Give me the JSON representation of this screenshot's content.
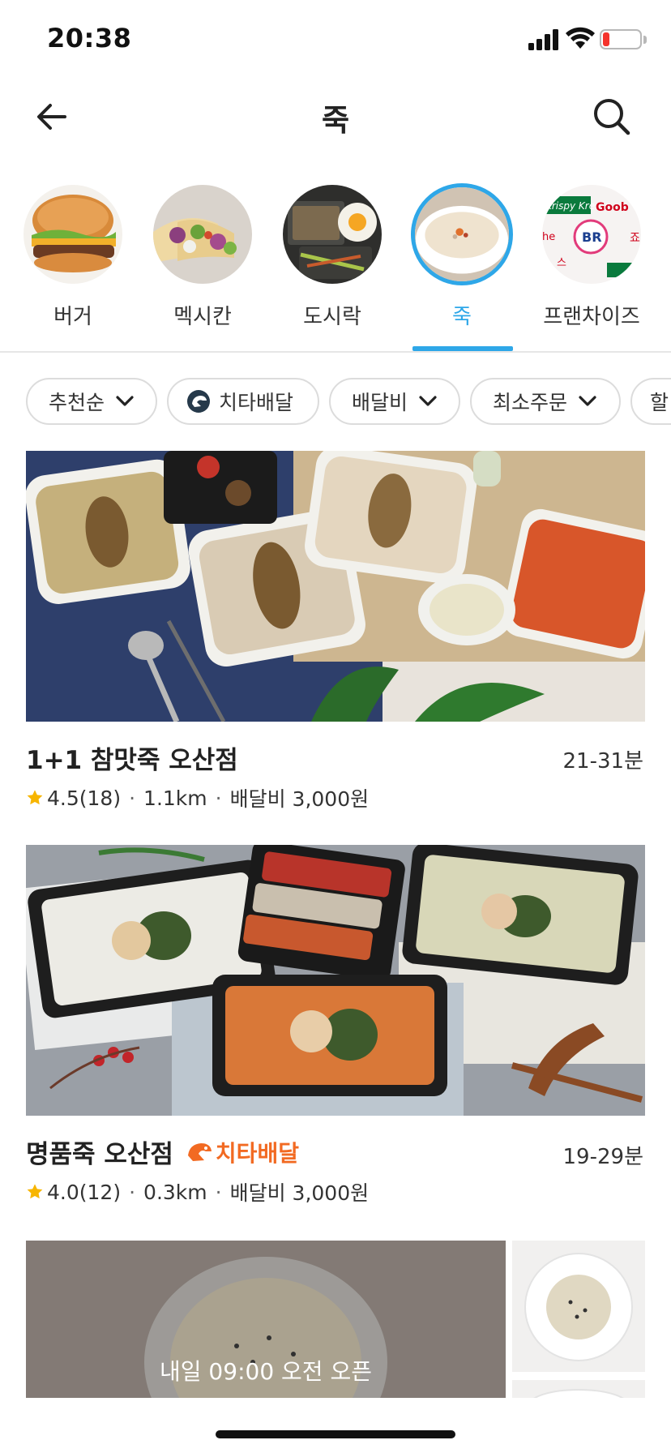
{
  "status": {
    "time": "20:38"
  },
  "header": {
    "title": "죽"
  },
  "categories": [
    {
      "label": "버거"
    },
    {
      "label": "멕시칸"
    },
    {
      "label": "도시락"
    },
    {
      "label": "죽"
    },
    {
      "label": "프랜차이즈"
    }
  ],
  "selected_category": "죽",
  "filters": [
    {
      "label": "추천순"
    },
    {
      "label": "치타배달"
    },
    {
      "label": "배달비"
    },
    {
      "label": "최소주문"
    },
    {
      "label": "할"
    }
  ],
  "restaurants": [
    {
      "name": "1+1 참맛죽 오산점",
      "time": "21-31분",
      "rating": "4.5",
      "reviews": "(18)",
      "distance": "1.1km",
      "delivery_fee": "배달비 3,000원"
    },
    {
      "name": "명품죽 오산점",
      "badge": "치타배달",
      "time": "19-29분",
      "rating": "4.0",
      "reviews": "(12)",
      "distance": "0.3km",
      "delivery_fee": "배달비 3,000원"
    },
    {
      "closed_notice": "내일 09:00 오전 오픈"
    }
  ],
  "colors": {
    "accent": "#2ea7e8",
    "cheetah": "#f26a22",
    "star": "#f7b500"
  }
}
